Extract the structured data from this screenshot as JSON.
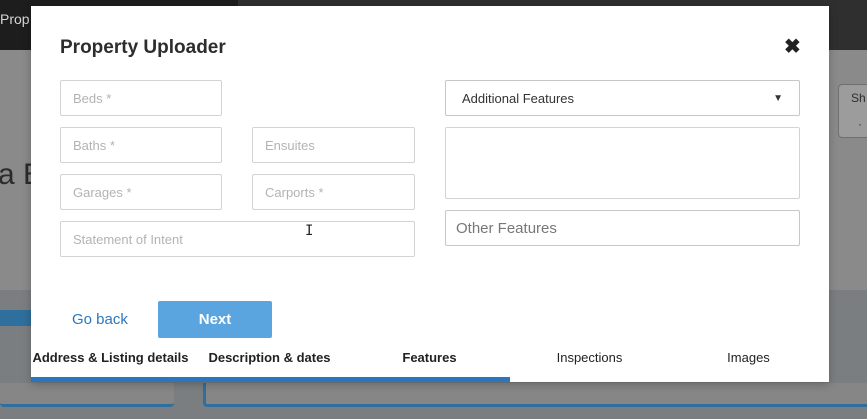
{
  "background": {
    "topbar_text": "Prop",
    "big_text": "a B",
    "side_label": "Sh",
    "side_icon": "·"
  },
  "modal": {
    "title": "Property Uploader",
    "close_icon": "✖",
    "fields": {
      "beds": {
        "placeholder": "Beds *",
        "value": ""
      },
      "baths": {
        "placeholder": "Baths *",
        "value": ""
      },
      "ensuites": {
        "placeholder": "Ensuites",
        "value": ""
      },
      "garages": {
        "placeholder": "Garages *",
        "value": ""
      },
      "carports": {
        "placeholder": "Carports *",
        "value": ""
      },
      "statement": {
        "placeholder": "Statement of Intent",
        "value": ""
      },
      "additional_features": {
        "selected": "Additional Features"
      },
      "other_features": {
        "placeholder": "Other Features",
        "value": ""
      }
    },
    "actions": {
      "go_back": "Go back",
      "next": "Next"
    },
    "tabs": [
      {
        "label": "Address & Listing details",
        "state": "done"
      },
      {
        "label": "Description & dates",
        "state": "done"
      },
      {
        "label": "Features",
        "state": "current"
      },
      {
        "label": "Inspections",
        "state": "pending"
      },
      {
        "label": "Images",
        "state": "pending"
      }
    ],
    "progress": 0.6
  },
  "colors": {
    "accent": "#2a77c0",
    "button": "#5aa4e0"
  }
}
